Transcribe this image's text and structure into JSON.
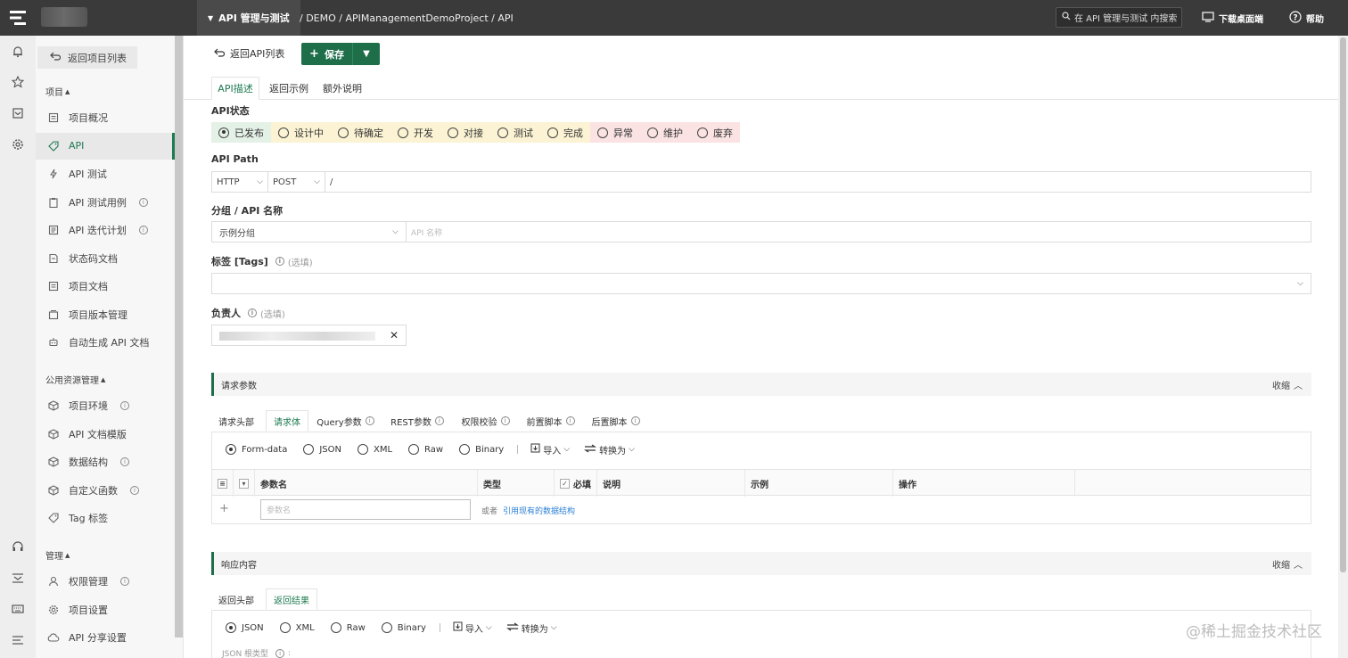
{
  "topbar": {
    "module": "API 管理与测试",
    "breadcrumb": "/ DEMO / APIManagementDemoProject / API",
    "search_placeholder": "在 API 管理与测试 内搜索",
    "download_label": "下载桌面端",
    "help_label": "帮助"
  },
  "sidebar": {
    "back_label": "返回项目列表",
    "section_project": "项目",
    "section_public": "公用资源管理",
    "section_manage": "管理",
    "items": [
      {
        "label": "项目概况",
        "icon": "document-icon"
      },
      {
        "label": "API",
        "icon": "tag-icon",
        "active": true
      },
      {
        "label": "API 测试",
        "icon": "lightning-icon"
      },
      {
        "label": "API 测试用例",
        "icon": "clipboard-icon",
        "info": true
      },
      {
        "label": "API 迭代计划",
        "icon": "list-icon",
        "info": true
      },
      {
        "label": "状态码文档",
        "icon": "doc-icon"
      },
      {
        "label": "项目文档",
        "icon": "document-icon"
      },
      {
        "label": "项目版本管理",
        "icon": "version-icon"
      },
      {
        "label": "自动生成 API 文档",
        "icon": "robot-icon"
      }
    ],
    "public_items": [
      {
        "label": "项目环境",
        "icon": "cube-icon",
        "info": true
      },
      {
        "label": "API 文档模版",
        "icon": "cube-icon"
      },
      {
        "label": "数据结构",
        "icon": "cube-icon",
        "info": true
      },
      {
        "label": "自定义函数",
        "icon": "cube-icon",
        "info": true
      },
      {
        "label": "Tag 标签",
        "icon": "tag-icon"
      }
    ],
    "manage_items": [
      {
        "label": "权限管理",
        "icon": "user-icon",
        "info": true
      },
      {
        "label": "项目设置",
        "icon": "gear-icon"
      },
      {
        "label": "API 分享设置",
        "icon": "cloud-icon"
      }
    ]
  },
  "toolbar": {
    "back_api_list": "返回API列表",
    "save_label": "保存"
  },
  "tabs": [
    "API描述",
    "返回示例",
    "额外说明"
  ],
  "status": {
    "label": "API状态",
    "options": [
      "已发布",
      "设计中",
      "待确定",
      "开发",
      "对接",
      "测试",
      "完成",
      "异常",
      "维护",
      "废弃"
    ],
    "selected": "已发布"
  },
  "path": {
    "label": "API Path",
    "protocol": "HTTP",
    "method": "POST",
    "value": "/"
  },
  "group": {
    "label": "分组 / API 名称",
    "group_value": "示例分组",
    "name_placeholder": "API 名称"
  },
  "tags": {
    "label": "标签 [Tags]",
    "optional": "(选填)"
  },
  "owner": {
    "label": "负责人",
    "optional": "(选填)"
  },
  "request": {
    "title": "请求参数",
    "collapse": "收缩",
    "tabs": [
      "请求头部",
      "请求体",
      "Query参数",
      "REST参数",
      "权限校验",
      "前置脚本",
      "后置脚本"
    ],
    "formats": [
      "Form-data",
      "JSON",
      "XML",
      "Raw",
      "Binary"
    ],
    "selected_format": "Form-data",
    "import_label": "导入",
    "convert_label": "转换为",
    "columns": [
      "参数名",
      "类型",
      "必填",
      "说明",
      "示例",
      "操作"
    ],
    "param_placeholder": "参数名",
    "or_text": "或者",
    "ref_link": "引用现有的数据结构"
  },
  "response": {
    "title": "响应内容",
    "collapse": "收缩",
    "tabs": [
      "返回头部",
      "返回结果"
    ],
    "formats": [
      "JSON",
      "XML",
      "Raw",
      "Binary"
    ],
    "selected_format": "JSON",
    "import_label": "导入",
    "convert_label": "转换为",
    "root_type_label": "JSON 根类型"
  },
  "watermark": "@稀土掘金技术社区",
  "colors": {
    "accent": "#1e6e4a",
    "topbar": "#3a3a3a"
  }
}
